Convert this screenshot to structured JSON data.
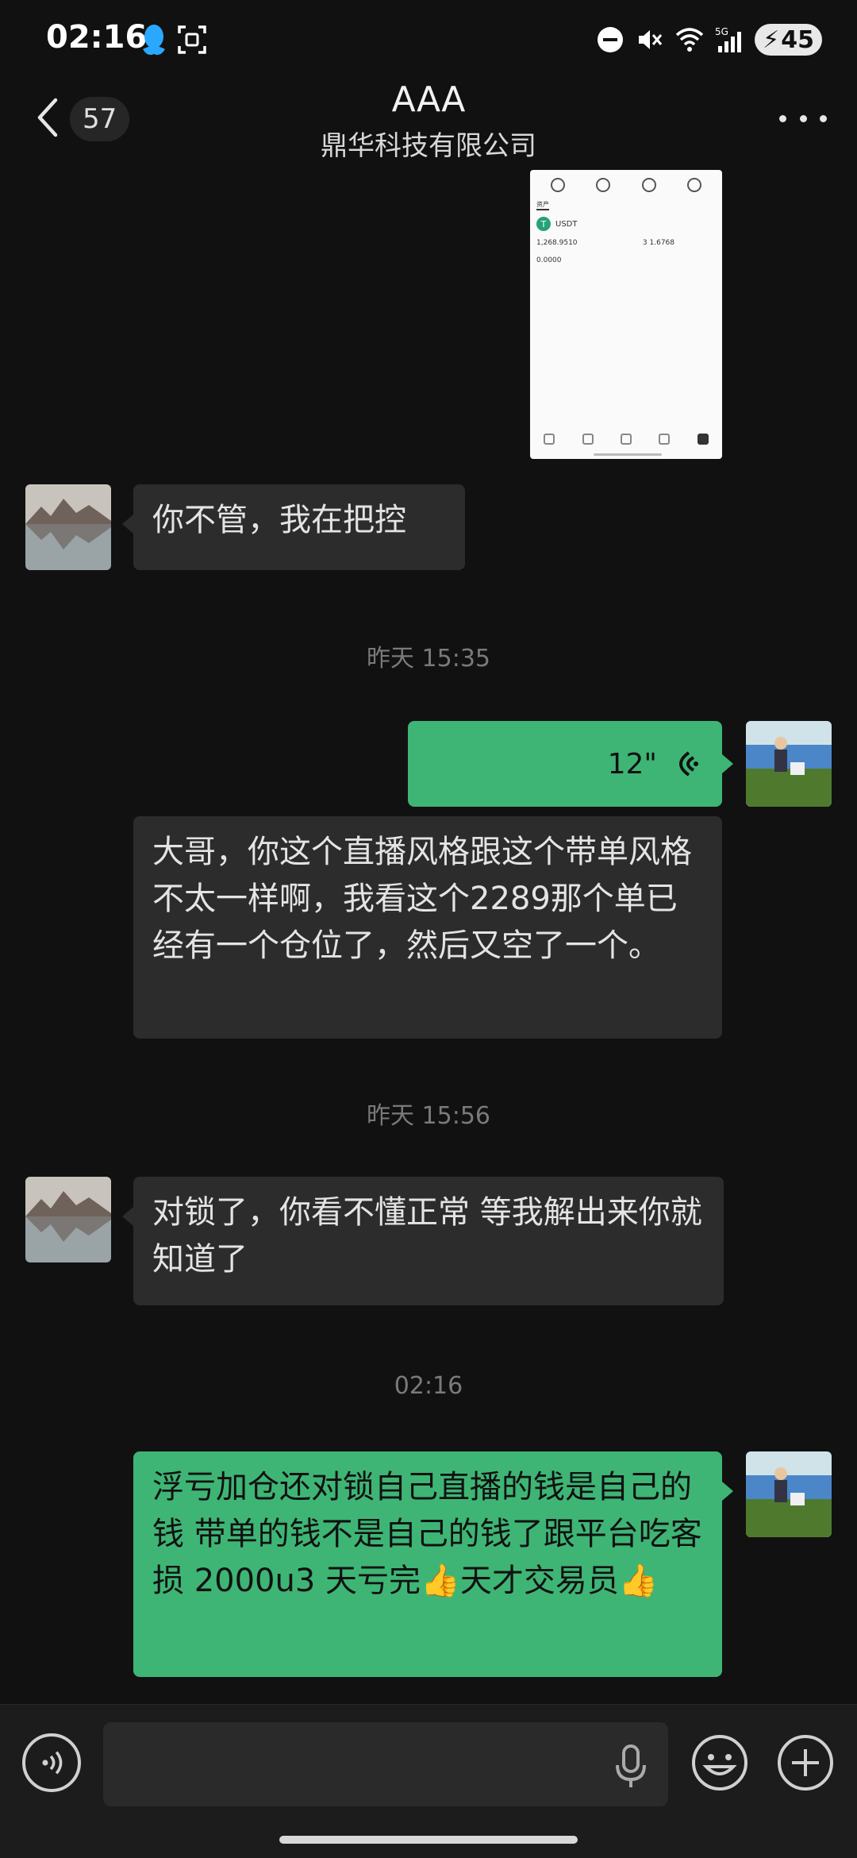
{
  "status": {
    "time": "02:16",
    "network": "5G",
    "battery": "45"
  },
  "header": {
    "back_count": "57",
    "title": "AAA",
    "subtitle": "鼎华科技有限公司"
  },
  "image_message": {
    "coin": "USDT",
    "value_left": "1,268.9510",
    "value_right": "3 1.6768",
    "value_bottom": "0.0000"
  },
  "messages": [
    {
      "side": "in",
      "text": "你不管，我在把控"
    },
    {
      "timestamp": "昨天 15:35"
    },
    {
      "side": "out",
      "type": "voice",
      "duration": "12\""
    },
    {
      "side": "in",
      "text": "大哥，你这个直播风格跟这个带单风格不太一样啊，我看这个2289那个单已经有一个仓位了，然后又空了一个。"
    },
    {
      "timestamp": "昨天 15:56"
    },
    {
      "side": "in",
      "text": "对锁了，你看不懂正常 等我解出来你就知道了"
    },
    {
      "timestamp": "02:16"
    },
    {
      "side": "out",
      "text": "浮亏加仓还对锁自己直播的钱是自己的钱 带单的钱不是自己的钱了跟平台吃客损 2000u3 天亏完👍天才交易员👍"
    }
  ],
  "input": {
    "value": ""
  },
  "icons": {
    "back": "back-arrow-icon",
    "more": "more-icon",
    "voice_toggle": "voice-toggle-icon",
    "mic": "mic-icon",
    "emoji": "emoji-icon",
    "plus": "plus-icon"
  },
  "colors": {
    "background": "#111111",
    "outgoing_bubble": "#3eb575",
    "incoming_bubble": "#2c2c2c"
  }
}
